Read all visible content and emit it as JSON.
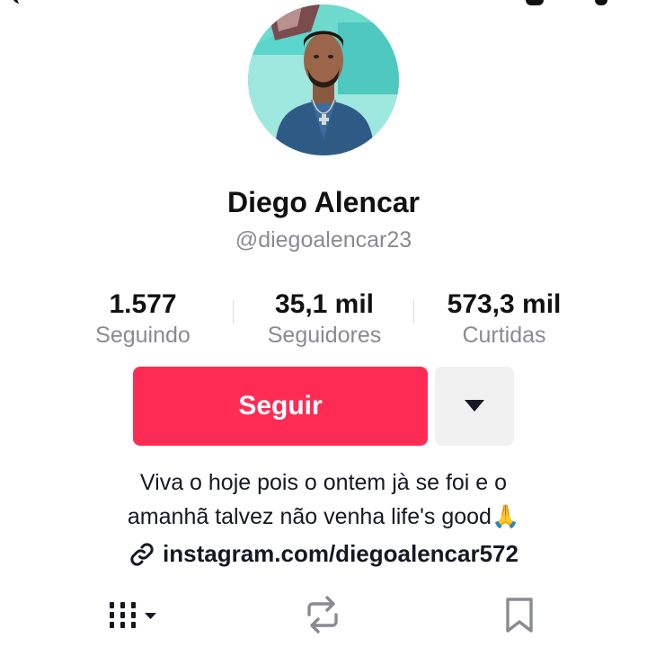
{
  "profile": {
    "display_name": "Diego Alencar",
    "username": "@diegoalencar23",
    "avatar_icon": "profile-photo"
  },
  "stats": [
    {
      "value": "1.577",
      "label": "Seguindo"
    },
    {
      "value": "35,1 mil",
      "label": "Seguidores"
    },
    {
      "value": "573,3 mil",
      "label": "Curtidas"
    }
  ],
  "actions": {
    "follow_label": "Seguir",
    "more_icon": "caret-down-icon"
  },
  "bio": {
    "line1": "Viva o hoje pois o ontem jà se foi e o",
    "line2": "amanhã talvez não venha life's good🙏"
  },
  "link": {
    "icon": "link-icon",
    "text": "instagram.com/diegoalencar572"
  },
  "tabs": [
    {
      "icon": "videos-grid-icon"
    },
    {
      "icon": "repost-icon"
    },
    {
      "icon": "bookmark-icon"
    }
  ],
  "colors": {
    "follow": "#fe2c55",
    "secondary_text": "#8a8b91",
    "more_bg": "#f1f1f2"
  }
}
